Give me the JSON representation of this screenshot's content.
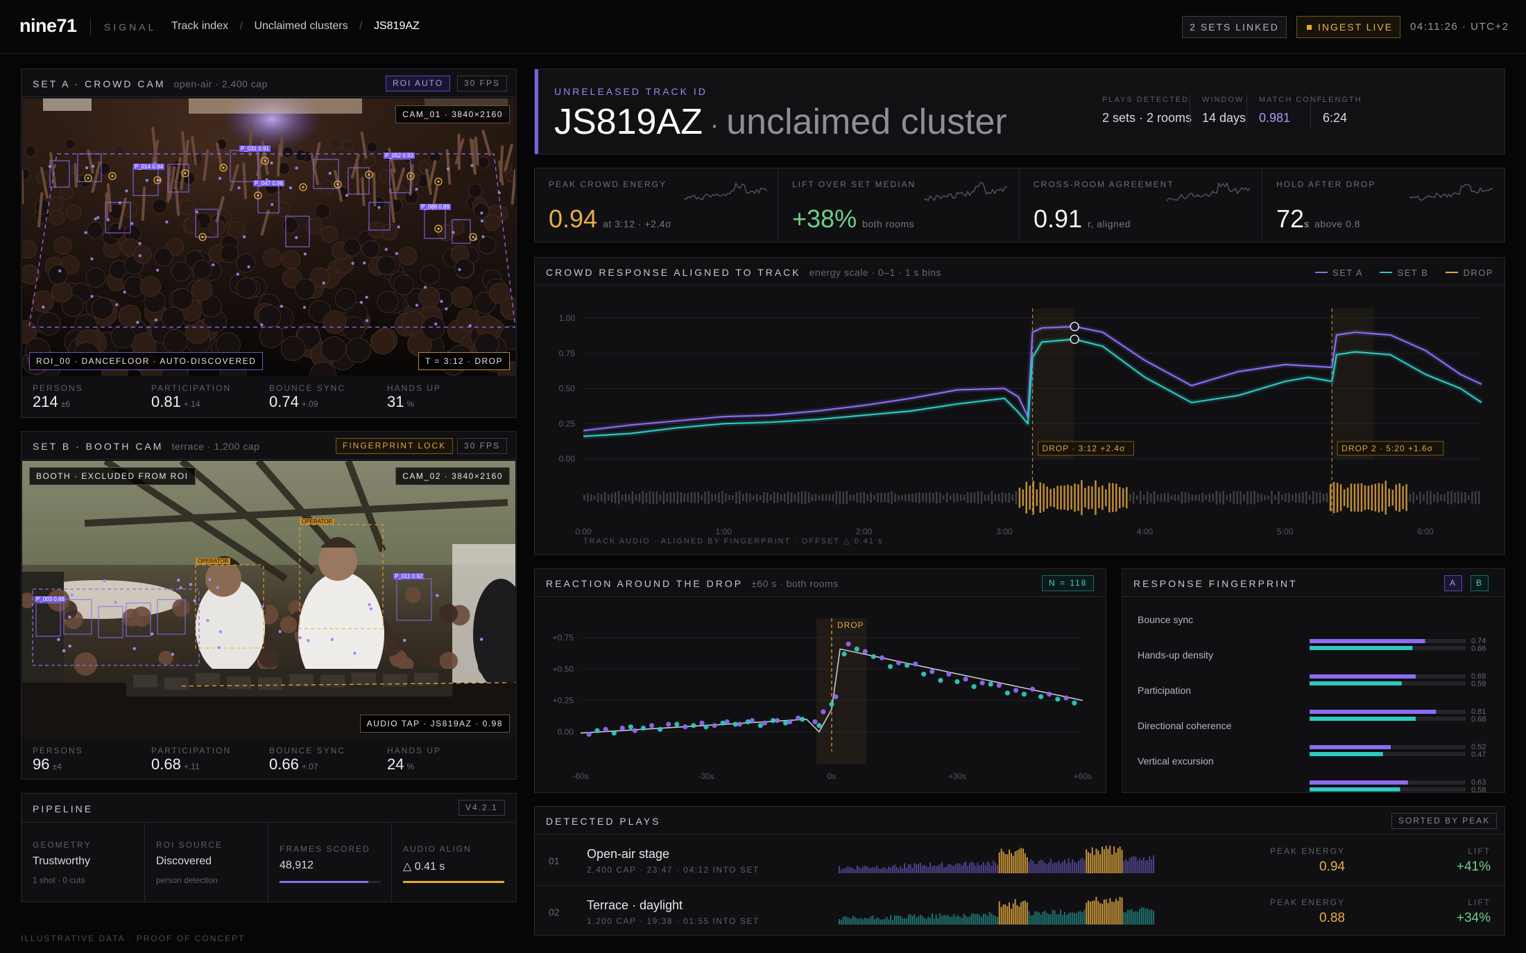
{
  "header": {
    "logo": "nine71",
    "section": "SIGNAL",
    "breadcrumb": [
      "Track index",
      "Unclaimed clusters",
      "JS819AZ"
    ],
    "breadcrumb_sep": "/",
    "sets_linked": "2 SETS LINKED",
    "ingest": "INGEST LIVE",
    "clock": "04:11:26 · UTC+2"
  },
  "set_a": {
    "title": "SET A · CROWD CAM",
    "subtitle": "open-air · 2,400 cap",
    "badge_roi": "ROI AUTO",
    "badge_fps": "30 FPS",
    "cam": "CAM_01 · 3840×2160",
    "roi_label": "ROI_00 · DANCEFLOOR · AUTO-DISCOVERED",
    "time_label": "T = 3:12 · DROP",
    "person_ids": [
      "P_014 0.94",
      "P_031 0.91",
      "P_047 0.96",
      "P_052 0.93",
      "P_088 0.89"
    ],
    "stats": [
      {
        "label": "PERSONS",
        "value": "214",
        "sub": "±6"
      },
      {
        "label": "PARTICIPATION",
        "value": "0.81",
        "sub": "+.14"
      },
      {
        "label": "BOUNCE SYNC",
        "value": "0.74",
        "sub": "+.09"
      },
      {
        "label": "HANDS UP",
        "value": "31",
        "sub": "%"
      }
    ]
  },
  "set_b": {
    "title": "SET B · BOOTH CAM",
    "subtitle": "terrace · 1,200 cap",
    "badge_lock": "FINGERPRINT LOCK",
    "badge_fps": "30 FPS",
    "booth": "BOOTH · EXCLUDED FROM ROI",
    "cam": "CAM_02 · 3840×2160",
    "audio_tap": "AUDIO TAP · JS819AZ · 0.98",
    "operator": "OPERATOR",
    "person_ids": [
      "P_003 0.88",
      "P_011 0.92"
    ],
    "stats": [
      {
        "label": "PERSONS",
        "value": "96",
        "sub": "±4"
      },
      {
        "label": "PARTICIPATION",
        "value": "0.68",
        "sub": "+.11"
      },
      {
        "label": "BOUNCE SYNC",
        "value": "0.66",
        "sub": "+.07"
      },
      {
        "label": "HANDS UP",
        "value": "24",
        "sub": "%"
      }
    ]
  },
  "pipeline": {
    "title": "PIPELINE",
    "version": "V4.2.1",
    "cells": [
      {
        "label": "GEOMETRY",
        "value": "Trustworthy",
        "sub": "1 shot · 0 cuts"
      },
      {
        "label": "ROI SOURCE",
        "value": "Discovered",
        "sub": "person detection"
      },
      {
        "label": "FRAMES SCORED",
        "value": "48,912",
        "progress": 0.88,
        "color": "#8b6cf0"
      },
      {
        "label": "AUDIO ALIGN",
        "value": "△ 0.41 s",
        "progress": 1.0,
        "color": "#e3a83a"
      }
    ]
  },
  "footer_note": "ILLUSTRATIVE DATA · PROOF OF CONCEPT",
  "track": {
    "eyebrow": "UNRELEASED TRACK ID",
    "id": "JS819AZ",
    "sep": "·",
    "name": "unclaimed cluster",
    "meta": [
      {
        "label": "PLAYS DETECTED",
        "value": "2 sets · 2 rooms"
      },
      {
        "label": "WINDOW",
        "value": "14 days"
      },
      {
        "label": "MATCH CONF.",
        "value": "0.981",
        "accent": true
      },
      {
        "label": "LENGTH",
        "value": "6:24"
      }
    ]
  },
  "kpis": [
    {
      "label": "PEAK CROWD ENERGY",
      "value": "0.94",
      "sub": "at 3:12 · +2.4σ",
      "color": "#e9ae45"
    },
    {
      "label": "LIFT OVER SET MEDIAN",
      "value": "+38%",
      "sub": "both rooms",
      "color": "#6fd08a"
    },
    {
      "label": "CROSS-ROOM AGREEMENT",
      "value": "0.91",
      "sub": "r, aligned",
      "color": "#f2f2f5"
    },
    {
      "label": "HOLD AFTER DROP",
      "value": "72",
      "unit": "s",
      "sub": "above 0.8",
      "color": "#f2f2f5"
    }
  ],
  "colors": {
    "set_a": "#8b6cf0",
    "set_b": "#2ec8c0",
    "drop": "#e3a83a",
    "positive": "#6fd08a"
  },
  "main_chart": {
    "title": "CROWD RESPONSE ALIGNED TO TRACK",
    "subtitle": "energy scale · 0–1 · 1 s bins",
    "legend": [
      "SET A",
      "SET B",
      "DROP"
    ],
    "legend_position": "top-right",
    "footer": "TRACK AUDIO · ALIGNED BY FINGERPRINT · OFFSET △ 0.41 s",
    "drop_labels": [
      "DROP · 3:12 +2.4σ",
      "DROP 2 · 5:20 +1.6σ"
    ]
  },
  "reaction_chart": {
    "title": "REACTION AROUND THE DROP",
    "subtitle": "±60 s · both rooms",
    "badge": "N = 118",
    "drop_label": "DROP"
  },
  "fingerprint": {
    "title": "RESPONSE FINGERPRINT",
    "badge_a": "A",
    "badge_b": "B",
    "rows": [
      {
        "label": "Bounce sync",
        "a": 0.74,
        "b": 0.66,
        "a_label": "0.74",
        "b_label": "0.66"
      },
      {
        "label": "Hands-up density",
        "a": 0.68,
        "b": 0.59,
        "a_label": "0.68",
        "b_label": "0.59"
      },
      {
        "label": "Participation",
        "a": 0.81,
        "b": 0.68,
        "a_label": "0.81",
        "b_label": "0.68"
      },
      {
        "label": "Directional coherence",
        "a": 0.52,
        "b": 0.47,
        "a_label": "0.52",
        "b_label": "0.47"
      },
      {
        "label": "Vertical excursion",
        "a": 0.63,
        "b": 0.58,
        "a_label": "0.63",
        "b_label": "0.58"
      }
    ]
  },
  "plays": {
    "title": "DETECTED PLAYS",
    "badge": "SORTED BY PEAK",
    "peak_label": "PEAK ENERGY",
    "lift_label": "LIFT",
    "rows": [
      {
        "index": "01",
        "name": "Open-air stage",
        "meta": "2,400 CAP · 23:47 · 04:12 INTO SET",
        "peak": "0.94",
        "lift": "+41%",
        "color": "#8b6cf0"
      },
      {
        "index": "02",
        "name": "Terrace · daylight",
        "meta": "1,200 CAP · 19:38 · 01:55 INTO SET",
        "peak": "0.88",
        "lift": "+34%",
        "color": "#2ec8c0"
      }
    ]
  },
  "chart_data": [
    {
      "type": "line",
      "title": "CROWD RESPONSE ALIGNED TO TRACK",
      "subtitle": "energy scale · 0–1 · 1 s bins",
      "xlabel": "",
      "ylabel": "",
      "xlim": [
        0,
        384
      ],
      "ylim": [
        0,
        1
      ],
      "y_ticks": [
        "0.00",
        "0.25",
        "0.50",
        "0.75",
        "1.00"
      ],
      "x_ticks": [
        "0:00",
        "1:00",
        "2:00",
        "3:00",
        "4:00",
        "5:00",
        "6:00"
      ],
      "legend": "top-right",
      "grid": true,
      "drops_seconds": [
        192,
        320
      ],
      "series": [
        {
          "name": "SET A",
          "x": [
            0,
            20,
            40,
            60,
            80,
            100,
            120,
            140,
            160,
            180,
            186,
            190,
            192,
            196,
            210,
            222,
            240,
            260,
            280,
            300,
            310,
            320,
            322,
            330,
            345,
            360,
            375,
            384
          ],
          "values": [
            0.2,
            0.24,
            0.27,
            0.3,
            0.31,
            0.34,
            0.38,
            0.43,
            0.49,
            0.5,
            0.44,
            0.3,
            0.9,
            0.93,
            0.94,
            0.9,
            0.7,
            0.52,
            0.62,
            0.67,
            0.66,
            0.65,
            0.88,
            0.9,
            0.88,
            0.77,
            0.6,
            0.53
          ]
        },
        {
          "name": "SET B",
          "x": [
            0,
            20,
            40,
            60,
            80,
            100,
            120,
            140,
            160,
            180,
            186,
            190,
            192,
            196,
            210,
            222,
            240,
            260,
            280,
            300,
            310,
            320,
            322,
            330,
            345,
            360,
            375,
            384
          ],
          "values": [
            0.16,
            0.18,
            0.22,
            0.25,
            0.26,
            0.28,
            0.31,
            0.34,
            0.39,
            0.43,
            0.33,
            0.25,
            0.72,
            0.83,
            0.85,
            0.8,
            0.58,
            0.4,
            0.45,
            0.55,
            0.58,
            0.55,
            0.74,
            0.76,
            0.74,
            0.6,
            0.5,
            0.4
          ]
        }
      ]
    },
    {
      "type": "scatter",
      "title": "REACTION AROUND THE DROP",
      "subtitle": "±60 s · both rooms",
      "x_ticks": [
        "-60s",
        "-30s",
        "0s",
        "+30s",
        "+60s"
      ],
      "y_ticks": [
        "0.00",
        "+0.25",
        "+0.50",
        "+0.75"
      ],
      "xlim": [
        -60,
        60
      ],
      "ylim": [
        -0.1,
        0.85
      ],
      "trend": {
        "x": [
          -60,
          -6,
          -3,
          0,
          2,
          60
        ],
        "values": [
          -0.01,
          0.1,
          0.0,
          0.18,
          0.66,
          0.25
        ]
      },
      "series": [
        {
          "name": "A",
          "x": [
            -58,
            -54,
            -50,
            -47,
            -43,
            -39,
            -35,
            -31,
            -28,
            -25,
            -22,
            -19,
            -16,
            -13,
            -10,
            -8,
            -4,
            -2,
            1,
            4,
            8,
            12,
            16,
            20,
            24,
            28,
            32,
            36,
            40,
            44,
            48,
            52,
            56
          ],
          "values": [
            -0.02,
            0.02,
            0.03,
            0.01,
            0.05,
            0.06,
            0.04,
            0.07,
            0.05,
            0.08,
            0.06,
            0.09,
            0.07,
            0.09,
            0.08,
            0.11,
            0.08,
            0.16,
            0.28,
            0.7,
            0.64,
            0.59,
            0.55,
            0.54,
            0.48,
            0.46,
            0.42,
            0.39,
            0.37,
            0.33,
            0.34,
            0.3,
            0.27
          ]
        },
        {
          "name": "B",
          "x": [
            -56,
            -52,
            -48,
            -45,
            -41,
            -37,
            -33,
            -30,
            -26,
            -23,
            -20,
            -17,
            -14,
            -11,
            -7,
            -3,
            0,
            3,
            6,
            10,
            14,
            18,
            22,
            26,
            30,
            34,
            38,
            42,
            46,
            50,
            54,
            58
          ],
          "values": [
            0.01,
            -0.01,
            0.04,
            0.03,
            0.02,
            0.06,
            0.05,
            0.04,
            0.07,
            0.06,
            0.08,
            0.05,
            0.09,
            0.07,
            0.1,
            0.05,
            0.22,
            0.62,
            0.66,
            0.6,
            0.52,
            0.53,
            0.46,
            0.41,
            0.4,
            0.36,
            0.38,
            0.31,
            0.3,
            0.28,
            0.26,
            0.23
          ]
        }
      ]
    },
    {
      "type": "bar",
      "title": "RESPONSE FINGERPRINT",
      "categories": [
        "Bounce sync",
        "Hands-up density",
        "Participation",
        "Directional coherence",
        "Vertical excursion"
      ],
      "series": [
        {
          "name": "A",
          "values": [
            0.74,
            0.68,
            0.81,
            0.52,
            0.63
          ]
        },
        {
          "name": "B",
          "values": [
            0.66,
            0.59,
            0.68,
            0.47,
            0.58
          ]
        }
      ]
    }
  ]
}
